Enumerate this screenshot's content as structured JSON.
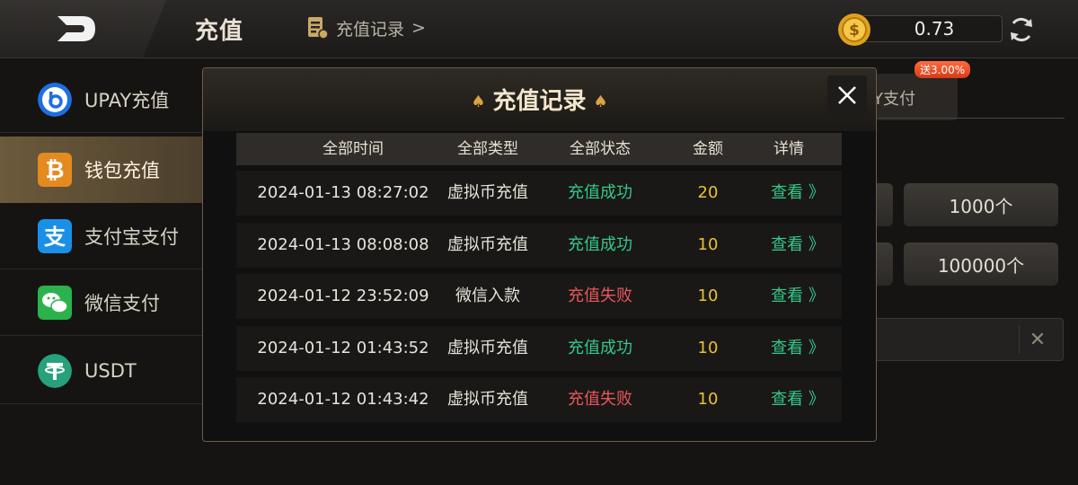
{
  "header": {
    "title": "充值",
    "records_link": "充值记录",
    "records_chevron": ">",
    "balance": "0.73"
  },
  "sidebar": {
    "items": [
      {
        "label": "UPAY充值",
        "icon": "upay-icon",
        "color": "#1e6fe0"
      },
      {
        "label": "钱包充值",
        "icon": "bitcoin-icon",
        "color": "#e58a1f"
      },
      {
        "label": "支付宝支付",
        "icon": "alipay-icon",
        "color": "#1a8fe8"
      },
      {
        "label": "微信支付",
        "icon": "wechat-icon",
        "color": "#2bb24c"
      },
      {
        "label": "USDT",
        "icon": "tether-icon",
        "color": "#26a17b"
      }
    ]
  },
  "background": {
    "tab_label": "Y支付",
    "bonus": "送3.00%",
    "amounts": [
      "1000个",
      "100000个"
    ]
  },
  "modal": {
    "title": "充值记录",
    "columns": [
      "全部时间",
      "全部类型",
      "全部状态",
      "金额",
      "详情"
    ],
    "rows": [
      {
        "time": "2024-01-13 08:27:02",
        "type": "虚拟币充值",
        "status": "充值成功",
        "amount": "20",
        "detail": "查看 》"
      },
      {
        "time": "2024-01-13 08:08:08",
        "type": "虚拟币充值",
        "status": "充值成功",
        "amount": "10",
        "detail": "查看 》"
      },
      {
        "time": "2024-01-12 23:52:09",
        "type": "微信入款",
        "status": "充值失败",
        "amount": "10",
        "detail": "查看 》"
      },
      {
        "time": "2024-01-12 01:43:52",
        "type": "虚拟币充值",
        "status": "充值成功",
        "amount": "10",
        "detail": "查看 》"
      },
      {
        "time": "2024-01-12 01:43:42",
        "type": "虚拟币充值",
        "status": "充值失败",
        "amount": "10",
        "detail": "查看 》"
      }
    ]
  },
  "colors": {
    "success": "#35c88a",
    "failure": "#e8575a",
    "amount": "#e9c234",
    "accent_gold": "#d9a441"
  }
}
